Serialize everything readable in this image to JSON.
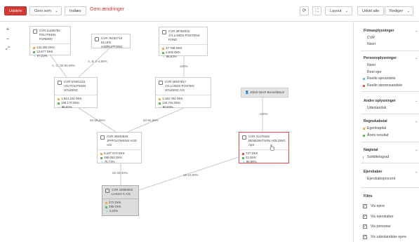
{
  "toolbar": {
    "udskriv": "Udskriv",
    "gem_som": "Gem som",
    "indlaes": "Indlæs",
    "unsaved_changes": "Gem ændringer",
    "layout": "Layout",
    "udvid_alle": "Udvid alle",
    "rediger": "Rediger"
  },
  "colors": {
    "accent": "#d03b36",
    "green": "#5cb85c",
    "orange": "#f0ad4e",
    "red": "#d9534f",
    "teal": "#5bc0de"
  },
  "nodes": [
    {
      "cvr": "CVR 11486792",
      "name": "POLITIKEN-FONDEN",
      "v1": "142.292 DKK",
      "v2": "13.677 DKK",
      "v3": "97,22%"
    },
    {
      "cvr": "CVR 76162718",
      "name": "ELLEN HJØRUPFOND"
    },
    {
      "cvr": "CVR 38762915",
      "name": "JYLLANDS-POSTENS FOND",
      "v1": "47.768 DKK",
      "v2": "2.505 DKK",
      "v3": "98,53%"
    },
    {
      "cvr": "CVR 57801415",
      "name": "A/S POLITIKEN HOLDING",
      "v1": "1.944.234 DKK",
      "v2": "168.170 DKK",
      "v3": "85,81%"
    },
    {
      "cvr": "CVR 30947817",
      "name": "JYLLANDS-POSTEN HOLDING A/S",
      "v1": "1.446.794 DKK",
      "v2": "144.734 DKK",
      "v3": "80,53%"
    },
    {
      "cvr": "CVR 26933628",
      "name": "JP/POLITIKENS HUS A/S",
      "v1": "5.247.673 DKK",
      "v2": "359.052 DKK",
      "v3": "75,73%"
    },
    {
      "cvr": "CVR 31479182",
      "name": "BENEDIKTSON HOLDING ApS",
      "v1": "727 DKK",
      "v2": "22 DKK",
      "v3": "89,96%"
    },
    {
      "cvr": "CVR 34580003",
      "name": "LASSO X A/S",
      "v1": "372 DKK",
      "v2": "286 DKK",
      "v3": "2,22%"
    }
  ],
  "person": {
    "name": "Jakob Bech Benediktson"
  },
  "edge_labels": [
    "A, C: 90-99,99%",
    "A, B: 5-4,99%",
    "100%",
    "50-66,66%",
    "50-66,66%",
    "100%",
    "25-33,33%",
    "15-19,99%"
  ],
  "sidebar": {
    "firma": {
      "title": "Firmaoplysninger",
      "items": [
        "CVR",
        "Navn"
      ]
    },
    "person": {
      "title": "Personoplysninger",
      "items": [
        "Navn",
        "Reel ejer",
        "Reelle ejerandele",
        "Reelle stemmeandele"
      ]
    },
    "andre": {
      "title": "Andre oplysninger",
      "items": [
        "Udenlandsk"
      ]
    },
    "regnskab": {
      "title": "Regnskabstal",
      "items": [
        "Egenkapital",
        "Årets resultat"
      ]
    },
    "noegletal": {
      "title": "Nøgletal",
      "items": [
        "Soliditetsgrad"
      ]
    },
    "ejerskaber": {
      "title": "Ejerskaber",
      "items": [
        "Ejerskabsprocent"
      ]
    },
    "filtre": {
      "title": "Filtre",
      "items": [
        "Vis ejere",
        "Vis ejerskaber",
        "Vis personer",
        "Vis udenlandske ejere"
      ]
    }
  }
}
